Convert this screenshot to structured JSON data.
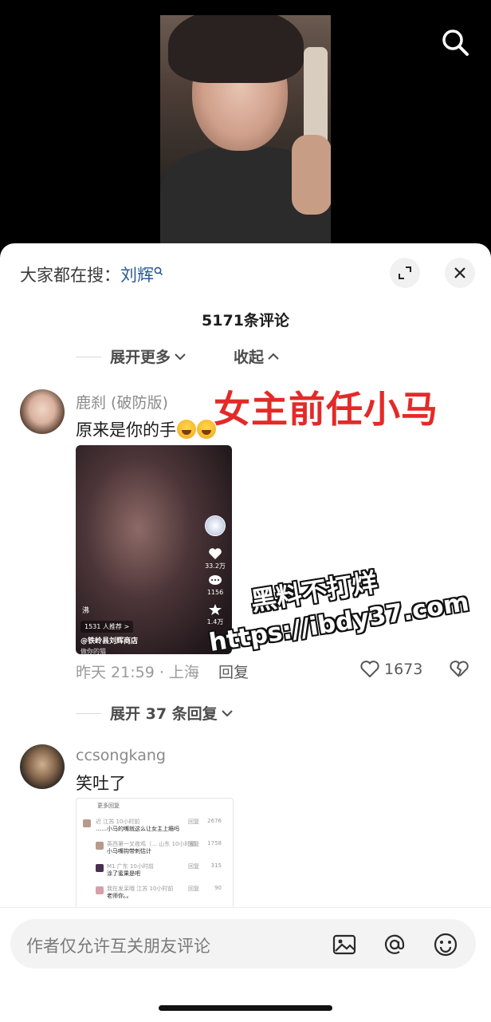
{
  "hot_search": {
    "prefix": "大家都在搜：",
    "keyword": "刘辉"
  },
  "comments_count_label": "5171条评论",
  "controls": {
    "expand_more": "展开更多",
    "collapse": "收起"
  },
  "overlay_caption": "女主前任小马",
  "watermark": {
    "line1": "黑料不打烊",
    "line2": "https://ibdy37.com"
  },
  "comments": [
    {
      "username": "鹿刹 (破防版)",
      "text": "原来是你的手",
      "video_card": {
        "like_count": "33.2万",
        "comment_count": "1156",
        "fav_count": "1.4万",
        "mark": "沸",
        "recommend": "1531 人推荐 >",
        "shop": "@铁岭县刘辉商店",
        "subtitle": "做你的猫"
      },
      "time": "昨天 21:59 · 上海",
      "reply_label": "回复",
      "likes": "1673",
      "expand_replies": "展开 37 条回复"
    },
    {
      "username": "ccsongkang",
      "text": "笑吐了",
      "screenshot": {
        "header": "更多回复",
        "rows": [
          {
            "name": "迟 江苏 10小时前",
            "text": "……小马的嘴就这么让女主上瘾吗",
            "reply": "回复",
            "num": "2676"
          },
          {
            "name": "英西第一叉夜鸡（… 山东 10小时前",
            "text": "小马嘴钩带刺估计",
            "reply": "回复",
            "num": "1758"
          },
          {
            "name": "M1 广东 10小时前",
            "text": "涂了蜜果是吧",
            "reply": "回复",
            "num": "315"
          },
          {
            "name": "我在发呆哦 江苏 10小时前",
            "text": "老师你。。",
            "reply": "回复",
            "num": "90"
          }
        ]
      }
    }
  ],
  "input": {
    "placeholder": "作者仅允许互关朋友评论"
  },
  "colors": {
    "accent_keyword": "#2b5a8f",
    "overlay_red": "#e32a28"
  }
}
